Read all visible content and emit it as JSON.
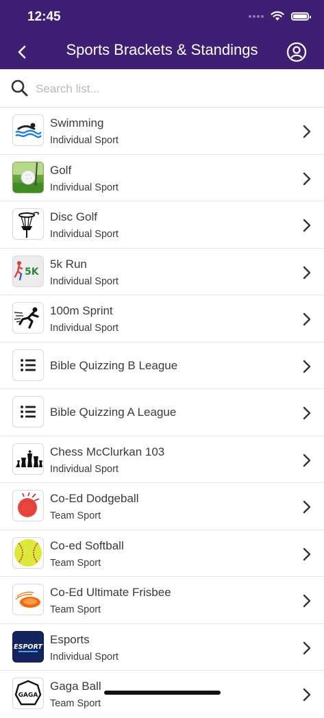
{
  "status": {
    "time": "12:45"
  },
  "header": {
    "title": "Sports Brackets & Standings"
  },
  "search": {
    "placeholder": "Search list..."
  },
  "items": [
    {
      "name": "Swimming",
      "type": "Individual Sport",
      "icon": "swimmer-icon"
    },
    {
      "name": "Golf",
      "type": "Individual Sport",
      "icon": "golf-ball-icon"
    },
    {
      "name": "Disc Golf",
      "type": "Individual Sport",
      "icon": "disc-golf-basket-icon"
    },
    {
      "name": "5k Run",
      "type": "Individual Sport",
      "icon": "5k-run-icon",
      "icon_text": "5K"
    },
    {
      "name": "100m Sprint",
      "type": "Individual Sport",
      "icon": "sprinter-icon"
    },
    {
      "name": "Bible Quizzing B League",
      "type": "",
      "icon": "list-icon"
    },
    {
      "name": "Bible Quizzing A League",
      "type": "",
      "icon": "list-icon"
    },
    {
      "name": "Chess McClurkan 103",
      "type": "Individual Sport",
      "icon": "chess-pieces-icon"
    },
    {
      "name": "Co-Ed Dodgeball",
      "type": "Team Sport",
      "icon": "dodgeball-icon"
    },
    {
      "name": "Co-ed Softball",
      "type": "Team Sport",
      "icon": "softball-icon"
    },
    {
      "name": "Co-Ed Ultimate Frisbee",
      "type": "Team Sport",
      "icon": "frisbee-icon"
    },
    {
      "name": "Esports",
      "type": "Individual Sport",
      "icon": "esports-icon",
      "icon_text": "ESPORT"
    },
    {
      "name": "Gaga Ball",
      "type": "Team Sport",
      "icon": "gaga-ball-icon",
      "icon_text": "GAGA"
    }
  ]
}
